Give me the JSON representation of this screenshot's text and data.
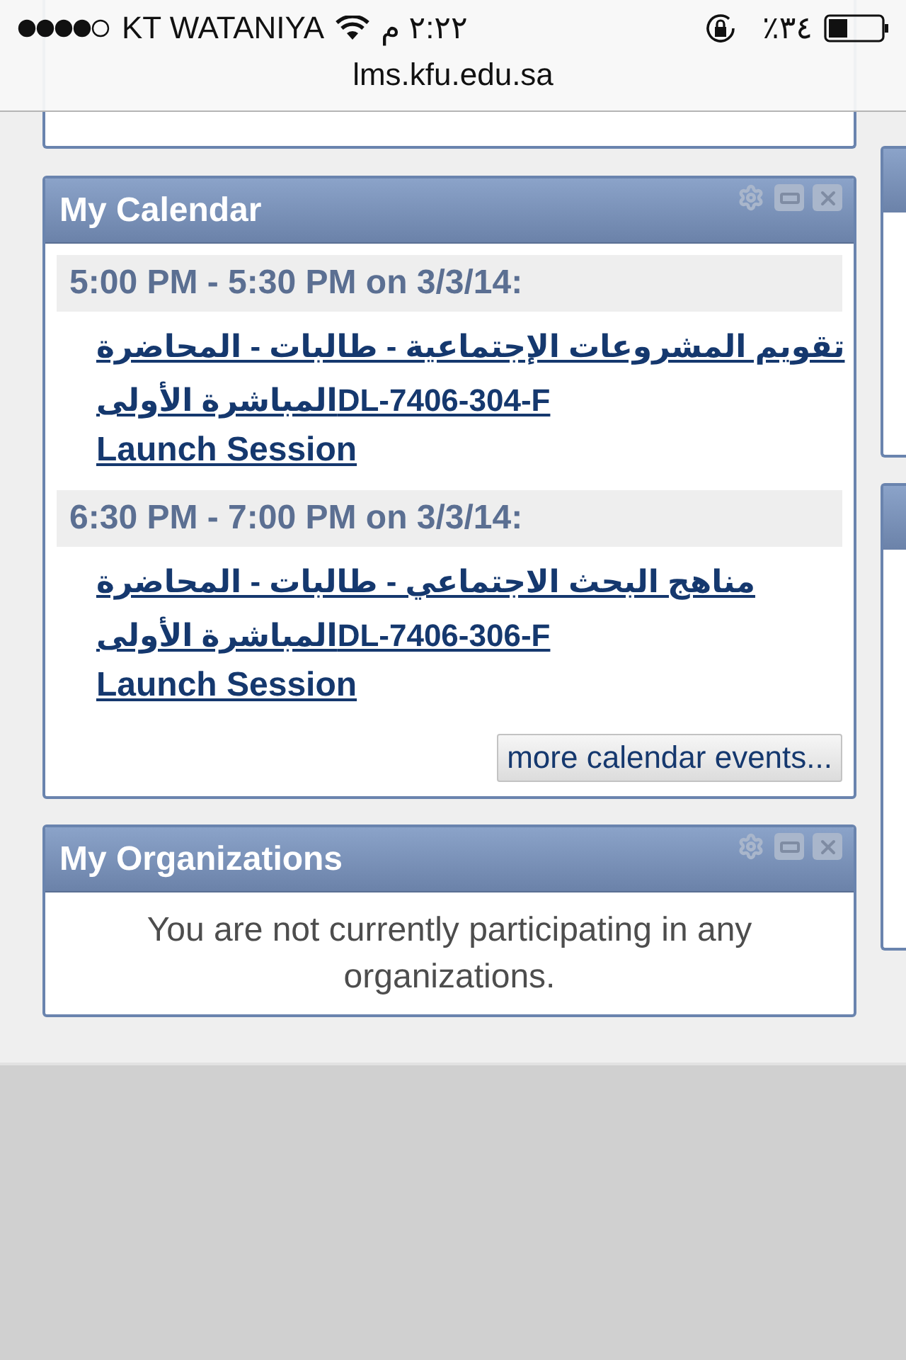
{
  "status_bar": {
    "carrier": "KT WATANIYA",
    "time": "٢:٢٢ م",
    "battery_percent": "٪٣٤",
    "url": "lms.kfu.edu.sa"
  },
  "calendar": {
    "title": "My Calendar",
    "events": [
      {
        "time": "5:00 PM - 5:30 PM on 3/3/14:",
        "course": "تقويم المشروعات الإجتماعية - طالبات - المحاضرة المباشرة الأولىDL-7406-304-F",
        "action": "Launch Session"
      },
      {
        "time": "6:30 PM - 7:00 PM on 3/3/14:",
        "course": "مناهج البحث الاجتماعي - طالبات - المحاضرة المباشرة الأولىDL-7406-306-F",
        "action": "Launch Session"
      }
    ],
    "more_button": "more calendar events..."
  },
  "organizations": {
    "title": "My Organizations",
    "message": "You are not currently participating in any organizations."
  }
}
